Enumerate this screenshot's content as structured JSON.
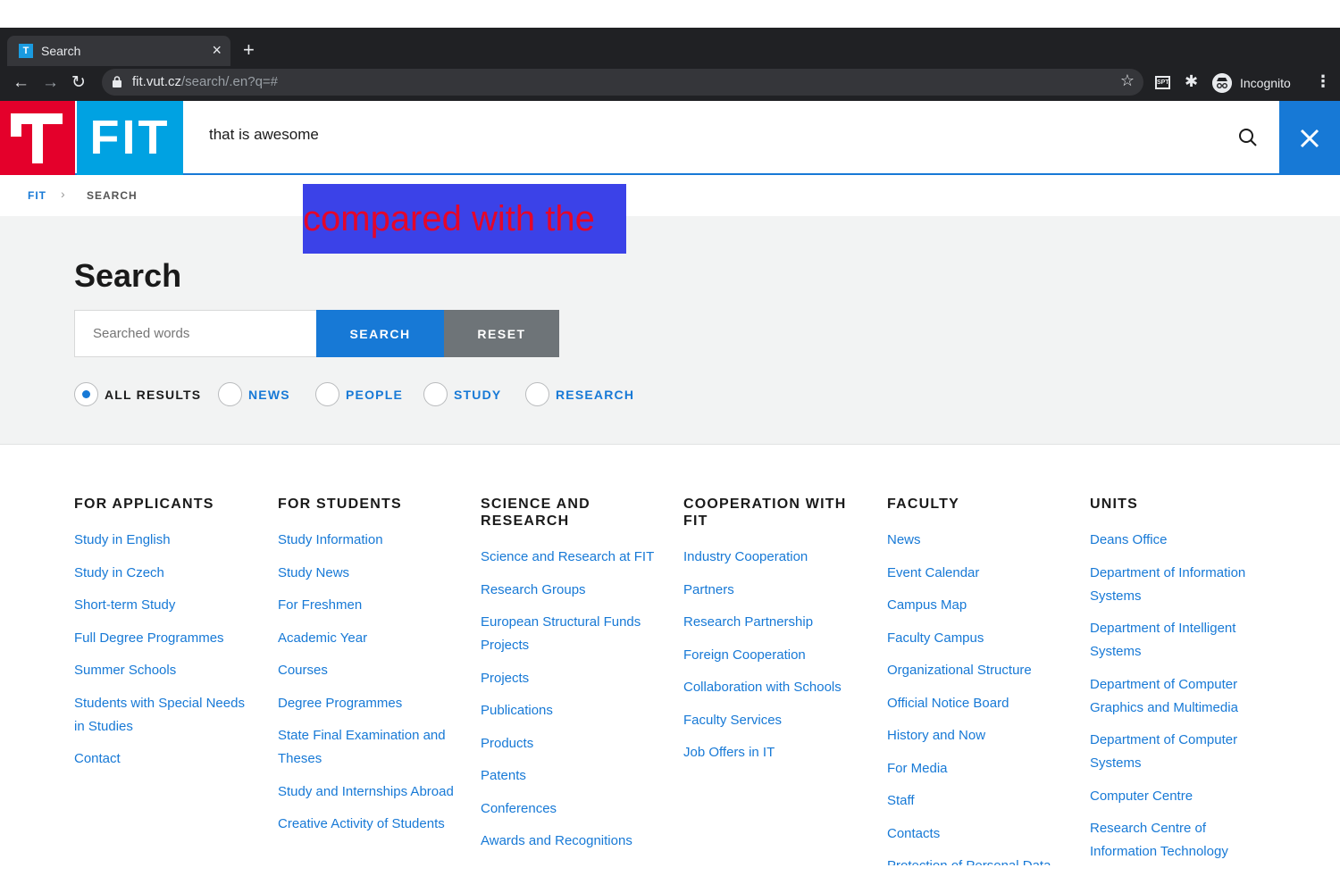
{
  "browser": {
    "tab_title": "Search",
    "tab_favicon": "T",
    "tab_close": "×",
    "new_tab": "+",
    "url_host": "fit.vut.cz",
    "url_path": "/search/.en?q=#",
    "ext_badge": "SPT",
    "incognito_label": "Incognito",
    "back": "←",
    "forward": "→",
    "reload": "↻",
    "star": "☆",
    "puzzle": "✱",
    "menu": "⋮"
  },
  "header": {
    "logo_text": "FIT",
    "search_value": "that is awesome",
    "colors": {
      "red": "#e4002b",
      "cyan": "#00a2e2",
      "blue": "#1779d6"
    }
  },
  "breadcrumb": {
    "items": [
      "FIT",
      "SEARCH"
    ],
    "separator": "›"
  },
  "overlay": {
    "text": "compared with the"
  },
  "search": {
    "title": "Search",
    "input_placeholder": "Searched words",
    "search_button": "SEARCH",
    "reset_button": "RESET",
    "filters": [
      {
        "label": "ALL RESULTS",
        "selected": true
      },
      {
        "label": "NEWS",
        "selected": false
      },
      {
        "label": "PEOPLE",
        "selected": false
      },
      {
        "label": "STUDY",
        "selected": false
      },
      {
        "label": "RESEARCH",
        "selected": false
      }
    ]
  },
  "footer": {
    "columns": [
      {
        "heading": "FOR APPLICANTS",
        "links": [
          "Study in English",
          "Study in Czech",
          "Short-term Study",
          "Full Degree Programmes",
          "Summer Schools",
          "Students with Special Needs in Studies",
          "Contact"
        ]
      },
      {
        "heading": "FOR STUDENTS",
        "links": [
          "Study Information",
          "Study News",
          "For Freshmen",
          "Academic Year",
          "Courses",
          "Degree Programmes",
          "State Final Examination and Theses",
          "Study and Internships Abroad",
          "Creative Activity of Students"
        ]
      },
      {
        "heading": "SCIENCE AND RESEARCH",
        "links": [
          "Science and Research at FIT",
          "Research Groups",
          "European Structural Funds Projects",
          "Projects",
          "Publications",
          "Products",
          "Patents",
          "Conferences",
          "Awards and Recognitions"
        ]
      },
      {
        "heading": "COOPERATION WITH FIT",
        "links": [
          "Industry Cooperation",
          "Partners",
          "Research Partnership",
          "Foreign Cooperation",
          "Collaboration with Schools",
          "Faculty Services",
          "Job Offers in IT"
        ]
      },
      {
        "heading": "FACULTY",
        "links": [
          "News",
          "Event Calendar",
          "Campus Map",
          "Faculty Campus",
          "Organizational Structure",
          "Official Notice Board",
          "History and Now",
          "For Media",
          "Staff",
          "Contacts",
          "Protection of Personal Data"
        ]
      },
      {
        "heading": "UNITS",
        "links": [
          "Deans Office",
          "Department of Information Systems",
          "Department of Intelligent Systems",
          "Department of Computer Graphics and Multimedia",
          "Department of Computer Systems",
          "Computer Centre",
          "Research Centre of Information Technology"
        ]
      }
    ]
  }
}
